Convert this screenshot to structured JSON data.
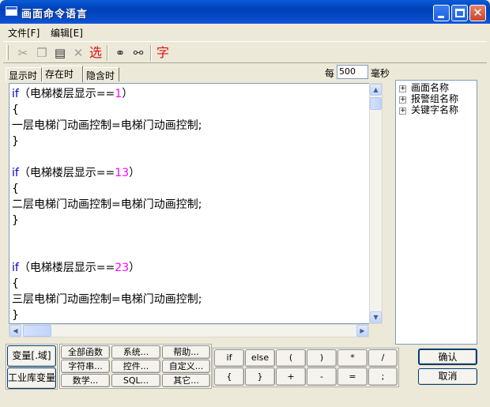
{
  "window": {
    "title": "画面命令语言"
  },
  "menu": [
    "文件[F]",
    "编辑[E]"
  ],
  "toolbar": {
    "select_label": "选",
    "font_label": "字"
  },
  "tabs": [
    "显示时",
    "存在时",
    "隐含时"
  ],
  "active_tab_index": 1,
  "period": {
    "prefix": "每",
    "value": "500",
    "unit": "毫秒"
  },
  "editor": {
    "blocks": [
      {
        "kw": "if",
        "cond_text": "（电梯楼层显示==",
        "cond_num": "1",
        "cond_close": "）",
        "open": "{",
        "stmt": "一层电梯门动画控制=电梯门动画控制;",
        "close": "}"
      },
      {
        "kw": "if",
        "cond_text": "（电梯楼层显示==",
        "cond_num": "13",
        "cond_close": "）",
        "open": "{",
        "stmt": "二层电梯门动画控制=电梯门动画控制;",
        "close": "}"
      },
      {
        "kw": "if",
        "cond_text": "（电梯楼层显示==",
        "cond_num": "23",
        "cond_close": "）",
        "open": "{",
        "stmt": "三层电梯门动画控制=电梯门动画控制;",
        "close": "}"
      }
    ]
  },
  "tree": [
    "画面名称",
    "报警组名称",
    "关键字名称"
  ],
  "var_buttons": [
    "变量[.域]",
    "工业库变量"
  ],
  "func_buttons": [
    [
      "全部函数",
      "系统...",
      "帮助..."
    ],
    [
      "字符串...",
      "控件...",
      "自定义..."
    ],
    [
      "数学...",
      "SQL...",
      "其它..."
    ]
  ],
  "op_buttons": [
    [
      "if",
      "else",
      "(",
      ")",
      "*",
      "/"
    ],
    [
      "{",
      "}",
      "+",
      "-",
      "=",
      ";"
    ]
  ],
  "actions": {
    "ok": "确认",
    "cancel": "取消"
  },
  "colors": {
    "keyword": "#0000c0",
    "number": "#ff00ff",
    "titlebar": "#0a5bd6"
  }
}
